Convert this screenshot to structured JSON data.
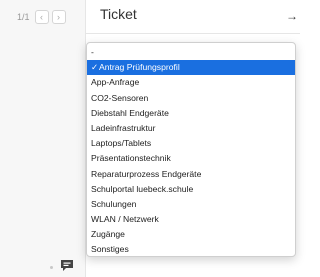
{
  "pager": {
    "count": "1/1",
    "prev_icon": "chevron-left-icon",
    "next_icon": "chevron-right-icon"
  },
  "panel": {
    "title": "Ticket",
    "forward_icon": "arrow-right-icon"
  },
  "dropdown": {
    "selected_index": 1,
    "check_mark": "✓",
    "selected_color": "#1a6fe0",
    "options": [
      "-",
      "Antrag Prüfungsprofil",
      "App-Anfrage",
      "CO2-Sensoren",
      "Diebstahl Endgeräte",
      "Ladeinfrastruktur",
      "Laptops/Tablets",
      "Präsentationstechnik",
      "Reparaturprozess Endgeräte",
      "Schulportal luebeck.schule",
      "Schulungen",
      "WLAN / Netzwerk",
      "Zugänge",
      "Sonstiges"
    ]
  },
  "chat": {
    "icon": "chat-bubble-icon"
  }
}
